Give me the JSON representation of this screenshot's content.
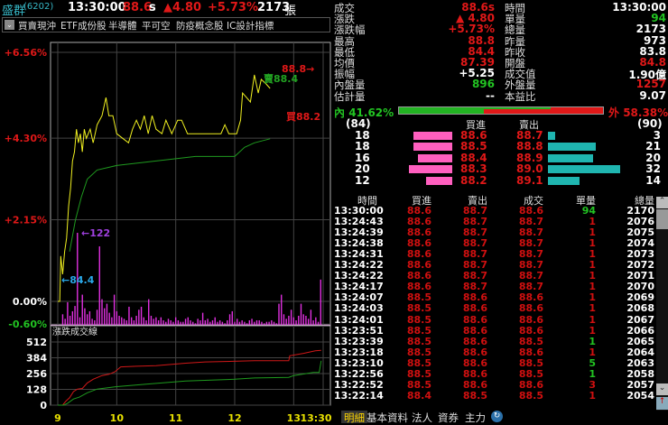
{
  "header": {
    "name": "盛群",
    "code": "(6202)",
    "time": "13:30:00",
    "price": "88.6",
    "price_flag": "s",
    "change": "▲4.80",
    "change_pct": "+5.73%",
    "volume": "2173",
    "volume_unit": "張"
  },
  "toolbar": {
    "items": [
      "買賣現沖",
      "ETF成份股",
      "半導體",
      "平可空",
      "防疫概念股",
      "IC設計指標"
    ]
  },
  "quote": {
    "left": [
      {
        "label": "成交",
        "value": "88.6s",
        "color": "red"
      },
      {
        "label": "漲跌",
        "value": "▲ 4.80",
        "color": "red"
      },
      {
        "label": "漲跌幅",
        "value": "+5.73%",
        "color": "red"
      },
      {
        "label": "最高",
        "value": "88.8",
        "color": "red"
      },
      {
        "label": "最低",
        "value": "84.4",
        "color": "red"
      },
      {
        "label": "均價",
        "value": "87.39",
        "color": "red"
      },
      {
        "label": "振幅",
        "value": "+5.25",
        "color": "white"
      },
      {
        "label": "內盤量",
        "value": "896",
        "color": "green"
      },
      {
        "label": "估計量",
        "value": "--",
        "color": "white"
      }
    ],
    "right": [
      {
        "label": "時間",
        "value": "13:30:00",
        "color": "white"
      },
      {
        "label": "單量",
        "value": "94",
        "color": "green"
      },
      {
        "label": "總量",
        "value": "2173",
        "color": "white"
      },
      {
        "label": "昨量",
        "value": "973",
        "color": "white"
      },
      {
        "label": "昨收",
        "value": "83.8",
        "color": "white"
      },
      {
        "label": "開盤",
        "value": "84.8",
        "color": "red"
      },
      {
        "label": "成交值",
        "value": "1.90億",
        "color": "white"
      },
      {
        "label": "外盤量",
        "value": "1257",
        "color": "red"
      },
      {
        "label": "本益比",
        "value": "9.07",
        "color": "white"
      }
    ]
  },
  "ratio": {
    "inner_label": "內",
    "inner_pct": "41.62%",
    "inner_value": 41.62,
    "outer_label": "外",
    "outer_pct": "58.38%"
  },
  "orderbook": {
    "bid_total": "(84)",
    "ask_total": "(90)",
    "bid_header": "買進",
    "ask_header": "賣出",
    "rows": [
      {
        "bid_qty": "18",
        "bid": "88.6",
        "ask": "88.7",
        "ask_qty": "3"
      },
      {
        "bid_qty": "18",
        "bid": "88.5",
        "ask": "88.8",
        "ask_qty": "21"
      },
      {
        "bid_qty": "16",
        "bid": "88.4",
        "ask": "88.9",
        "ask_qty": "20"
      },
      {
        "bid_qty": "20",
        "bid": "88.3",
        "ask": "89.0",
        "ask_qty": "32"
      },
      {
        "bid_qty": "12",
        "bid": "88.2",
        "ask": "89.1",
        "ask_qty": "14"
      }
    ]
  },
  "ticks": {
    "headers": [
      "時間",
      "買進",
      "賣出",
      "成交",
      "單量",
      "總量"
    ],
    "rows": [
      [
        "13:30:00",
        "88.6",
        "88.7",
        "88.6",
        "94",
        "2170",
        "green"
      ],
      [
        "13:24:43",
        "88.6",
        "88.7",
        "88.7",
        "1",
        "2076",
        "red"
      ],
      [
        "13:24:39",
        "88.6",
        "88.7",
        "88.7",
        "1",
        "2075",
        "red"
      ],
      [
        "13:24:38",
        "88.6",
        "88.7",
        "88.7",
        "1",
        "2074",
        "red"
      ],
      [
        "13:24:31",
        "88.6",
        "88.7",
        "88.7",
        "1",
        "2073",
        "red"
      ],
      [
        "13:24:22",
        "88.6",
        "88.7",
        "88.7",
        "1",
        "2072",
        "red"
      ],
      [
        "13:24:22",
        "88.6",
        "88.7",
        "88.7",
        "1",
        "2071",
        "red"
      ],
      [
        "13:24:17",
        "88.6",
        "88.7",
        "88.7",
        "1",
        "2070",
        "red"
      ],
      [
        "13:24:07",
        "88.5",
        "88.6",
        "88.6",
        "1",
        "2069",
        "red"
      ],
      [
        "13:24:03",
        "88.5",
        "88.6",
        "88.6",
        "1",
        "2068",
        "red"
      ],
      [
        "13:24:01",
        "88.5",
        "88.6",
        "88.6",
        "1",
        "2067",
        "red"
      ],
      [
        "13:23:51",
        "88.5",
        "88.6",
        "88.6",
        "1",
        "2066",
        "red"
      ],
      [
        "13:23:39",
        "88.5",
        "88.6",
        "88.5",
        "1",
        "2065",
        "green"
      ],
      [
        "13:23:18",
        "88.5",
        "88.6",
        "88.6",
        "1",
        "2064",
        "red"
      ],
      [
        "13:23:10",
        "88.5",
        "88.6",
        "88.5",
        "5",
        "2063",
        "green"
      ],
      [
        "13:22:56",
        "88.5",
        "88.6",
        "88.5",
        "1",
        "2058",
        "green"
      ],
      [
        "13:22:52",
        "88.5",
        "88.6",
        "88.6",
        "3",
        "2057",
        "red"
      ],
      [
        "13:22:14",
        "88.4",
        "88.5",
        "88.5",
        "1",
        "2054",
        "red"
      ]
    ]
  },
  "tabs": [
    "明細",
    "基本資料",
    "法人",
    "資券",
    "主力"
  ],
  "chart_data": {
    "type": "line",
    "prev_close": 83.8,
    "y_ticks": [
      "+6.56%",
      "+4.30%",
      "+2.15%",
      "0.00%",
      "-0.60%"
    ],
    "y_tick_values": [
      6.56,
      4.3,
      2.15,
      0,
      -0.6
    ],
    "x_ticks": [
      "9",
      "10",
      "11",
      "12",
      "13",
      "13:30"
    ],
    "x_tick_minutes": [
      0,
      60,
      120,
      180,
      240,
      270
    ],
    "annotations": {
      "high": "88.8→",
      "sell": "賣88.4",
      "buy": "買88.2",
      "low": "←84.4",
      "max_vol": "←122"
    },
    "price": [
      [
        0,
        83.8
      ],
      [
        2,
        83.8
      ],
      [
        3,
        84.8
      ],
      [
        5,
        84.4
      ],
      [
        7,
        84.9
      ],
      [
        9,
        85.2
      ],
      [
        11,
        85.9
      ],
      [
        13,
        86.3
      ],
      [
        15,
        86.9
      ],
      [
        17,
        87.1
      ],
      [
        19,
        87.6
      ],
      [
        21,
        87.3
      ],
      [
        23,
        87.5
      ],
      [
        25,
        87.1
      ],
      [
        27,
        87.6
      ],
      [
        29,
        87.4
      ],
      [
        33,
        87.6
      ],
      [
        36,
        87.3
      ],
      [
        40,
        87.7
      ],
      [
        45,
        87.9
      ],
      [
        49,
        88.3
      ],
      [
        52,
        87.9
      ],
      [
        56,
        87.9
      ],
      [
        60,
        87.5
      ],
      [
        66,
        87.4
      ],
      [
        72,
        87.3
      ],
      [
        76,
        87.6
      ],
      [
        80,
        87.8
      ],
      [
        84,
        87.6
      ],
      [
        88,
        87.9
      ],
      [
        92,
        87.5
      ],
      [
        96,
        87.9
      ],
      [
        100,
        87.6
      ],
      [
        106,
        87.5
      ],
      [
        110,
        87.8
      ],
      [
        116,
        87.5
      ],
      [
        122,
        87.8
      ],
      [
        126,
        87.8
      ],
      [
        132,
        87.5
      ],
      [
        150,
        87.5
      ],
      [
        166,
        87.5
      ],
      [
        170,
        87.7
      ],
      [
        174,
        87.5
      ],
      [
        182,
        87.5
      ],
      [
        186,
        87.8
      ],
      [
        188,
        88.4
      ],
      [
        192,
        88.3
      ],
      [
        196,
        88.2
      ],
      [
        200,
        88.8
      ],
      [
        204,
        88.4
      ],
      [
        207,
        88.7
      ],
      [
        212,
        88.6
      ],
      [
        216,
        88.5
      ]
    ],
    "average": [
      [
        12,
        84.9
      ],
      [
        18,
        85.6
      ],
      [
        24,
        86.1
      ],
      [
        30,
        86.5
      ],
      [
        40,
        86.7
      ],
      [
        60,
        86.8
      ],
      [
        100,
        86.9
      ],
      [
        140,
        87.0
      ],
      [
        180,
        87.0
      ],
      [
        190,
        87.2
      ],
      [
        200,
        87.3
      ],
      [
        216,
        87.39
      ]
    ],
    "volume_y_ticks": [
      "512",
      "384",
      "256",
      "128",
      "0"
    ],
    "volume_label": "漲跌成交線",
    "volume": [
      0,
      0,
      14,
      8,
      30,
      12,
      18,
      25,
      122,
      10,
      40,
      22,
      14,
      18,
      8,
      6,
      20,
      104,
      34,
      22,
      28,
      16,
      10,
      40,
      18,
      12,
      10,
      8,
      6,
      24,
      10,
      6,
      12,
      20,
      24,
      10,
      6,
      34,
      12,
      8,
      10,
      6,
      10,
      6,
      4,
      8,
      6,
      4,
      10,
      6,
      4,
      4,
      8,
      10,
      6,
      4,
      2,
      8,
      6,
      16,
      6,
      8,
      4,
      6,
      10,
      4,
      6,
      4,
      2,
      6,
      14,
      18,
      4,
      8,
      4,
      6,
      4,
      2,
      6,
      8,
      4,
      6,
      6,
      4,
      2,
      4,
      4,
      6,
      4,
      2,
      28,
      40,
      14,
      8,
      12,
      20,
      10,
      6,
      12,
      28,
      14,
      12,
      8,
      20,
      6,
      10,
      4,
      60
    ],
    "cum_outer": [
      [
        0,
        0
      ],
      [
        5,
        0
      ],
      [
        8,
        30
      ],
      [
        12,
        60
      ],
      [
        16,
        110
      ],
      [
        20,
        130
      ],
      [
        25,
        135
      ],
      [
        30,
        180
      ],
      [
        36,
        210
      ],
      [
        45,
        240
      ],
      [
        52,
        250
      ],
      [
        58,
        270
      ],
      [
        64,
        310
      ],
      [
        80,
        315
      ],
      [
        100,
        320
      ],
      [
        130,
        340
      ],
      [
        150,
        350
      ],
      [
        200,
        360
      ],
      [
        235,
        360
      ],
      [
        236,
        400
      ],
      [
        250,
        420
      ],
      [
        262,
        440
      ],
      [
        268,
        445
      ]
    ],
    "cum_inner": [
      [
        0,
        0
      ],
      [
        6,
        0
      ],
      [
        10,
        15
      ],
      [
        16,
        50
      ],
      [
        22,
        65
      ],
      [
        30,
        100
      ],
      [
        40,
        130
      ],
      [
        60,
        150
      ],
      [
        90,
        170
      ],
      [
        130,
        195
      ],
      [
        180,
        210
      ],
      [
        200,
        220
      ],
      [
        235,
        225
      ],
      [
        240,
        240
      ],
      [
        260,
        265
      ],
      [
        266,
        265
      ],
      [
        268,
        360
      ]
    ]
  }
}
